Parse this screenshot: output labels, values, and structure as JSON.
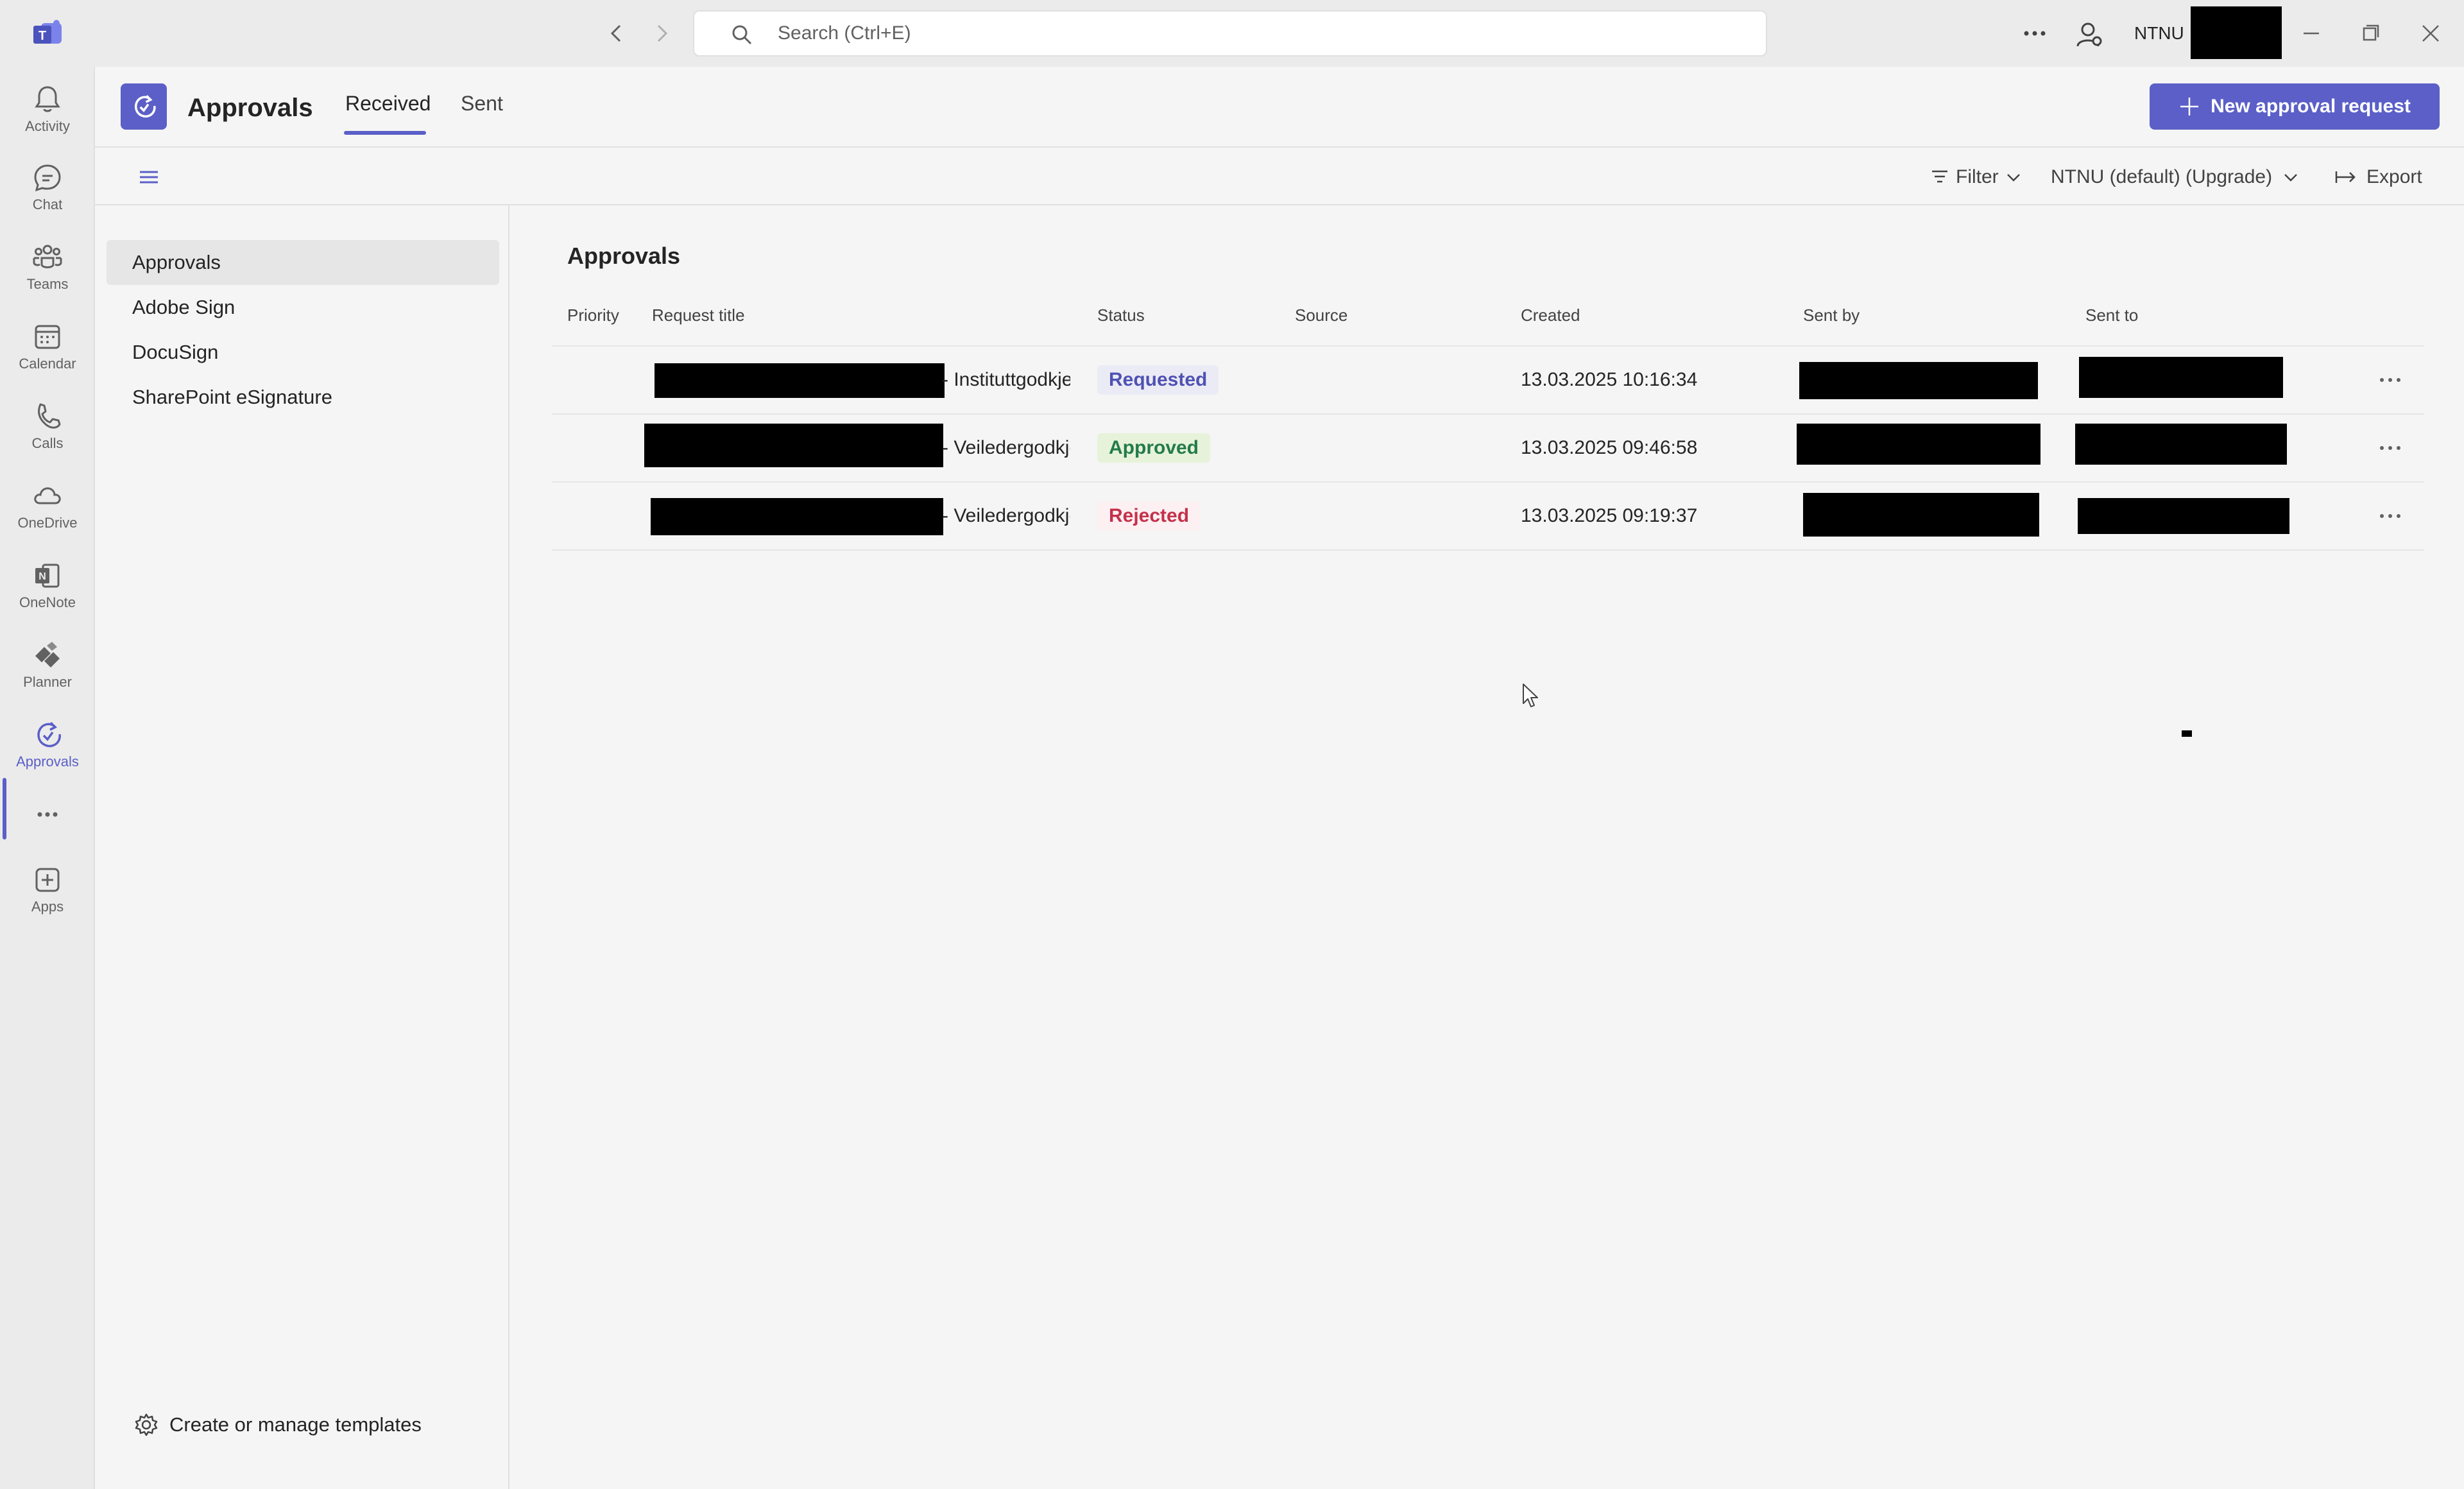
{
  "titlebar": {
    "search_placeholder": "Search (Ctrl+E)",
    "org_name": "NTNU"
  },
  "rail": {
    "items": [
      {
        "label": "Activity",
        "icon": "bell-icon"
      },
      {
        "label": "Chat",
        "icon": "chat-icon"
      },
      {
        "label": "Teams",
        "icon": "teams-icon"
      },
      {
        "label": "Calendar",
        "icon": "calendar-icon"
      },
      {
        "label": "Calls",
        "icon": "phone-icon"
      },
      {
        "label": "OneDrive",
        "icon": "cloud-icon"
      },
      {
        "label": "OneNote",
        "icon": "onenote-icon"
      },
      {
        "label": "Planner",
        "icon": "planner-icon"
      },
      {
        "label": "Approvals",
        "icon": "approvals-icon"
      },
      {
        "label": "",
        "icon": "more-icon"
      },
      {
        "label": "Apps",
        "icon": "add-app-icon"
      }
    ],
    "active": "Approvals"
  },
  "header": {
    "app_title": "Approvals",
    "tabs": [
      {
        "label": "Received",
        "active": true
      },
      {
        "label": "Sent",
        "active": false
      }
    ],
    "new_button_label": "New approval request"
  },
  "toolbar": {
    "filter_label": "Filter",
    "environment_label": "NTNU (default) (Upgrade)",
    "export_label": "Export"
  },
  "side_panel": {
    "items": [
      {
        "label": "Approvals",
        "selected": true
      },
      {
        "label": "Adobe Sign",
        "selected": false
      },
      {
        "label": "DocuSign",
        "selected": false
      },
      {
        "label": "SharePoint eSignature",
        "selected": false
      }
    ],
    "templates_link": "Create or manage templates"
  },
  "main": {
    "title": "Approvals",
    "columns": [
      "Priority",
      "Request title",
      "Status",
      "Source",
      "Created",
      "Sent by",
      "Sent to"
    ],
    "rows": [
      {
        "title_suffix": "- Instituttgodkje",
        "status": "Requested",
        "created": "13.03.2025 10:16:34"
      },
      {
        "title_suffix": "- Veiledergodkje",
        "status": "Approved",
        "created": "13.03.2025 09:46:58"
      },
      {
        "title_suffix": "- Veiledergodkje",
        "status": "Rejected",
        "created": "13.03.2025 09:19:37"
      }
    ]
  },
  "colors": {
    "accent": "#5b5fc7",
    "requested": "#4f52b2",
    "approved": "#237b4b",
    "rejected": "#c4314b"
  }
}
